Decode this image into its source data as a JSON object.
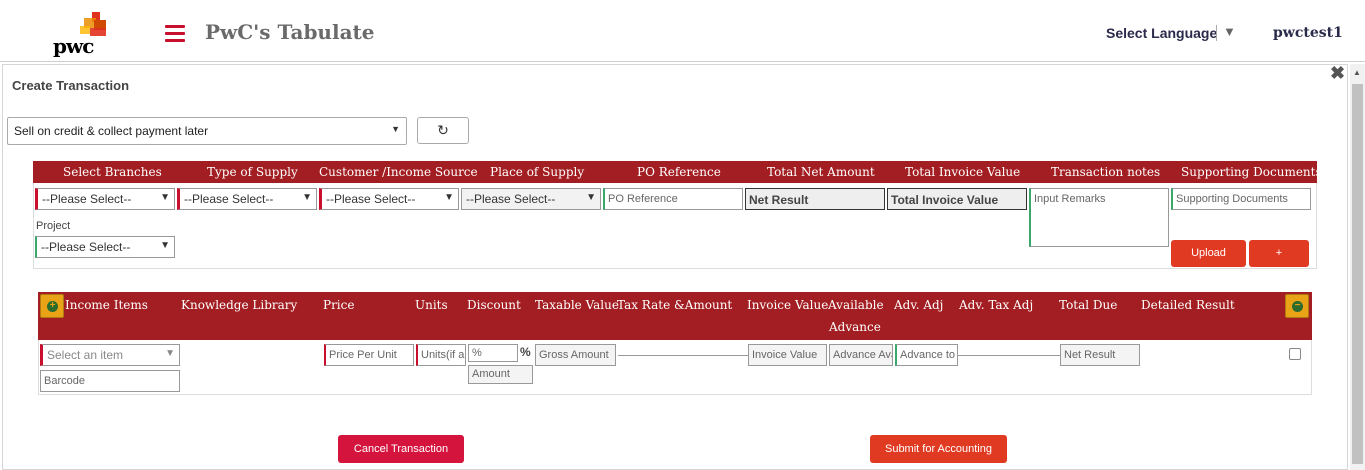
{
  "header": {
    "logo_text": "pwc",
    "app_title": "PwC's Tabulate",
    "language_label": "Select Language",
    "language_caret": "▼",
    "username": "pwctest1"
  },
  "page": {
    "title": "Create Transaction",
    "close_glyph": "✖"
  },
  "mode_select": {
    "value": "Sell on credit & collect payment later",
    "caret": "▼"
  },
  "refresh_glyph": "↻",
  "details": {
    "headers": [
      "Select Branches",
      "Type of Supply",
      "Customer /Income Source",
      "Place of Supply",
      "PO Reference",
      "Total Net Amount",
      "Total Invoice Value",
      "Transaction notes",
      "Supporting Documents"
    ],
    "branches_value": "--Please Select--",
    "supply_type_value": "--Please Select--",
    "customer_value": "--Please Select--",
    "place_value": "--Please Select--",
    "po_reference_placeholder": "PO Reference",
    "net_amount_value": "Net Result",
    "invoice_value": "Total Invoice Value",
    "notes_placeholder": "Input Remarks",
    "supporting_placeholder": "Supporting Documents",
    "project_label": "Project",
    "project_value": "--Please Select--",
    "upload_label": "Upload",
    "add_label": "+"
  },
  "items": {
    "headers": [
      "Income Items",
      "Knowledge Library",
      "Price",
      "Units",
      "Discount",
      "Taxable Value",
      "Tax Rate &Amount",
      "Invoice Value",
      "Available",
      "Advance",
      "Adv. Adj",
      "Adv. Tax Adj",
      "Total Due",
      "Detailed Result"
    ],
    "add_glyph": "+",
    "remove_glyph": "−",
    "item_select_placeholder": "Select an item",
    "barcode_placeholder": "Barcode",
    "price_placeholder": "Price Per Unit",
    "units_placeholder": "Units(if any)",
    "discount_pct_placeholder": "%",
    "pct_symbol": "%",
    "discount_amount_placeholder": "Amount",
    "gross_amount_placeholder": "Gross Amount",
    "invoice_value_placeholder": "Invoice Value",
    "available_advance_placeholder": "Advance Available",
    "advance_to_adjust_placeholder": "Advance to Adjust",
    "net_result_placeholder": "Net Result"
  },
  "actions": {
    "cancel_label": "Cancel Transaction",
    "submit_label": "Submit for Accounting"
  },
  "colors": {
    "header_red": "#a31e22",
    "button_red": "#e03a22",
    "cancel_crimson": "#d4143d",
    "accent_green": "#3aa76d"
  }
}
